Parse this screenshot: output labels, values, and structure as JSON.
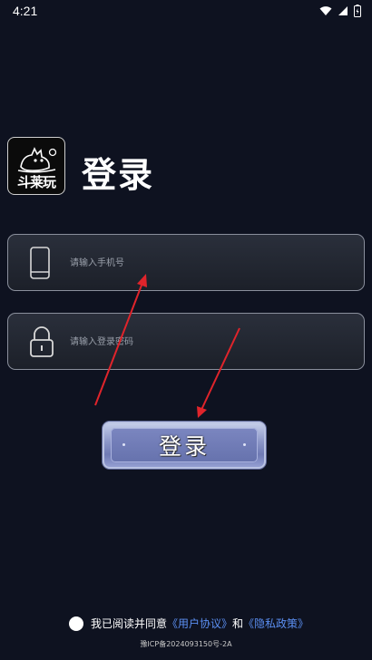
{
  "status_bar": {
    "time": "4:21"
  },
  "app": {
    "logo_text": "斗莱玩",
    "title": "登录"
  },
  "phone_field": {
    "placeholder": "请输入手机号",
    "value": ""
  },
  "password_field": {
    "placeholder": "请输入登录密码",
    "value": ""
  },
  "login_button": {
    "label": "登录"
  },
  "agreement": {
    "prefix": "我已阅读并同意",
    "user_agreement": "《用户协议》",
    "conjunction": "和",
    "privacy_policy": "《隐私政策》"
  },
  "footer": {
    "icp": "豫ICP备2024093150号-2A"
  },
  "colors": {
    "background": "#0e1220",
    "link": "#5b8ff2",
    "annotation_arrow": "#e0242b"
  }
}
